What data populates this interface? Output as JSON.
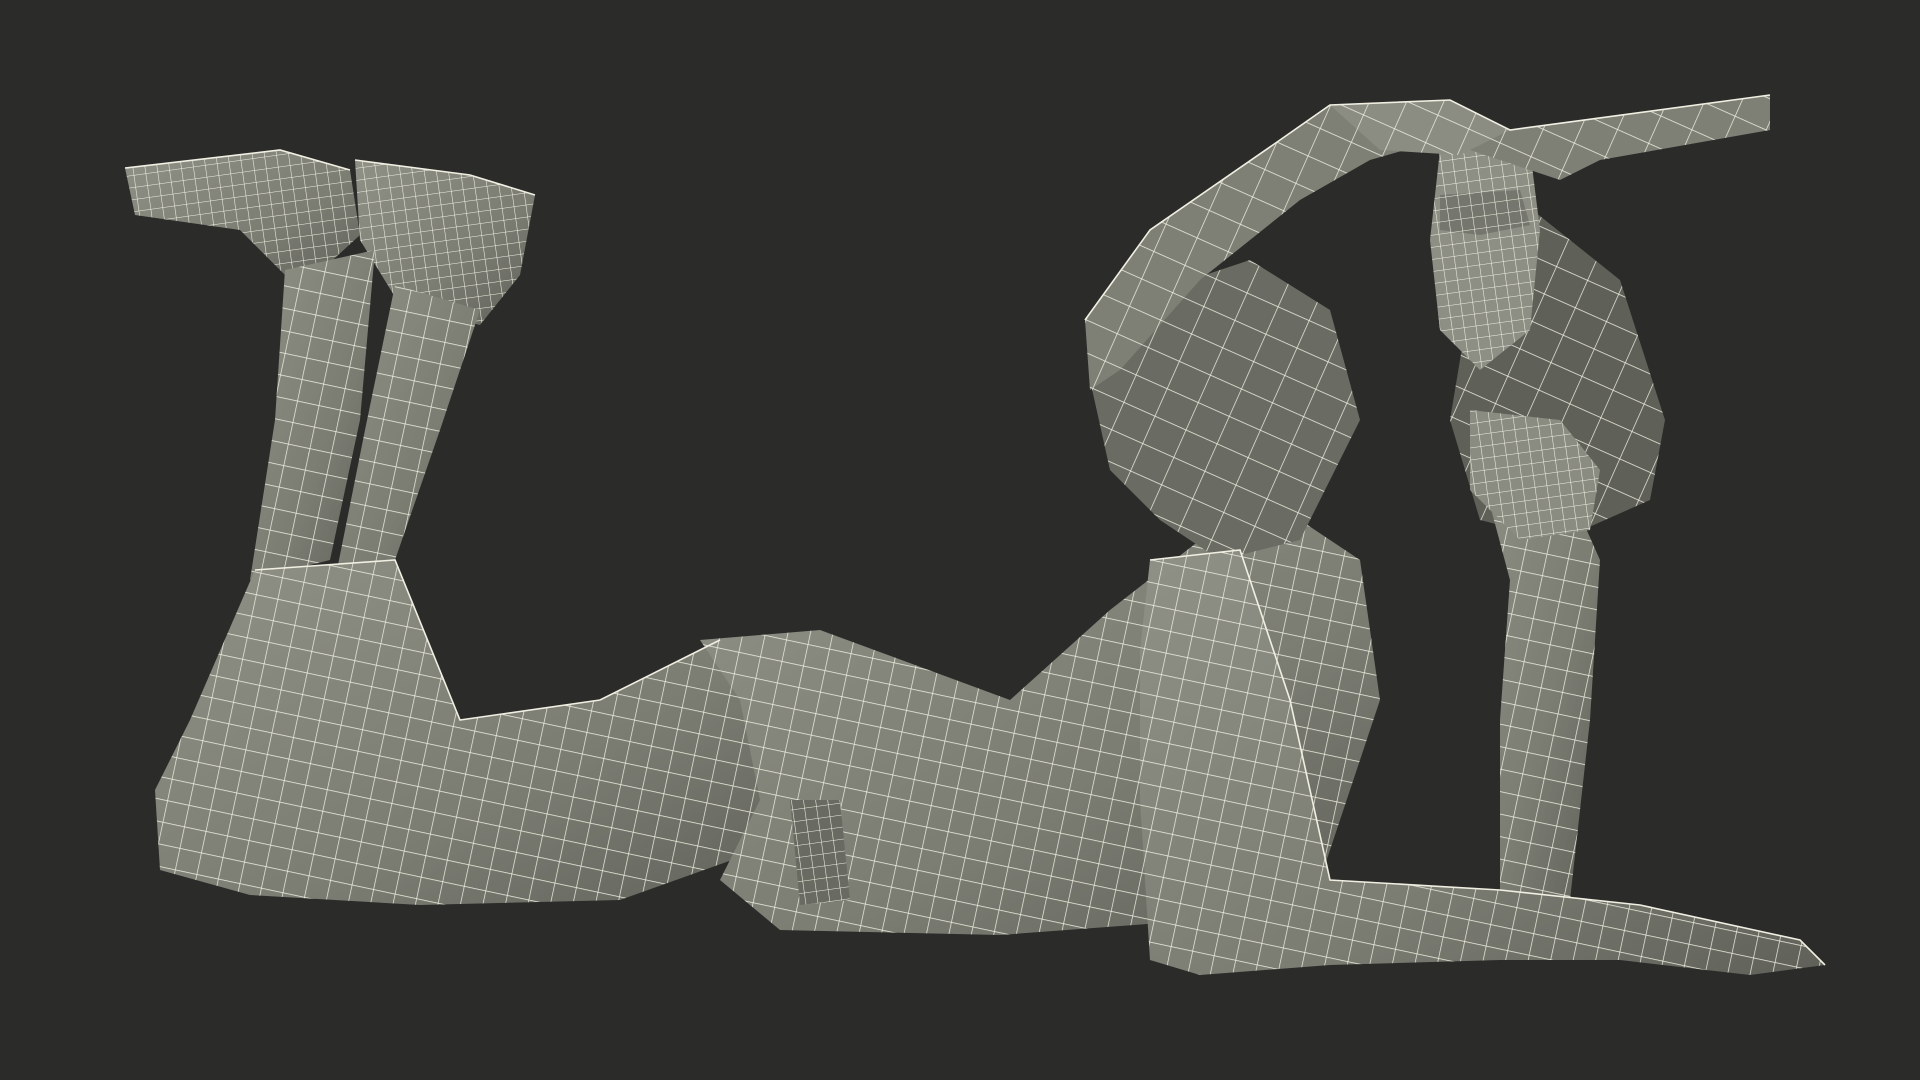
{
  "scene": {
    "subject": "wireframe-figure",
    "background_color": "#2b2b2a",
    "mesh_fill_color": "#7b7d73",
    "mesh_shade_color": "#5f6058",
    "mesh_light_color": "#8f9187",
    "wire_color": "#f1efe2"
  }
}
